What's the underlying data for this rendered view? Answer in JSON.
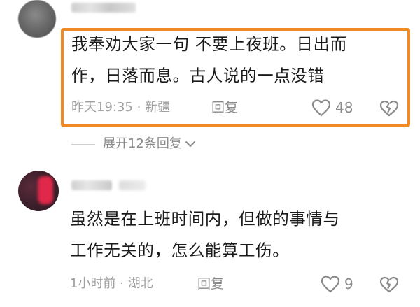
{
  "comments": [
    {
      "text_line1": "我奉劝大家一句  不要上夜班。日出而",
      "text_line2": "作，日落而息。古人说的一点没错",
      "time": "昨天19:35",
      "location": "新疆",
      "meta": "昨天19:35 · 新疆",
      "reply_label": "回复",
      "likes": "48",
      "highlighted": true,
      "highlight_color": "#f08a24"
    },
    {
      "text_line1": "虽然是在上班时间内，但做的事情与",
      "text_line2": "工作无关的，怎么能算工伤。",
      "meta": "1小时前 · 湖北",
      "reply_label": "回复",
      "likes": "9",
      "highlighted": false
    }
  ],
  "expand_replies_label": "展开12条回复",
  "icons": {
    "like": "heart-outline-icon",
    "dislike": "broken-heart-icon",
    "expand": "chevron-down-icon"
  },
  "colors": {
    "text": "#1a1a1a",
    "meta": "#a0a0a0",
    "action": "#8a8a8a"
  }
}
